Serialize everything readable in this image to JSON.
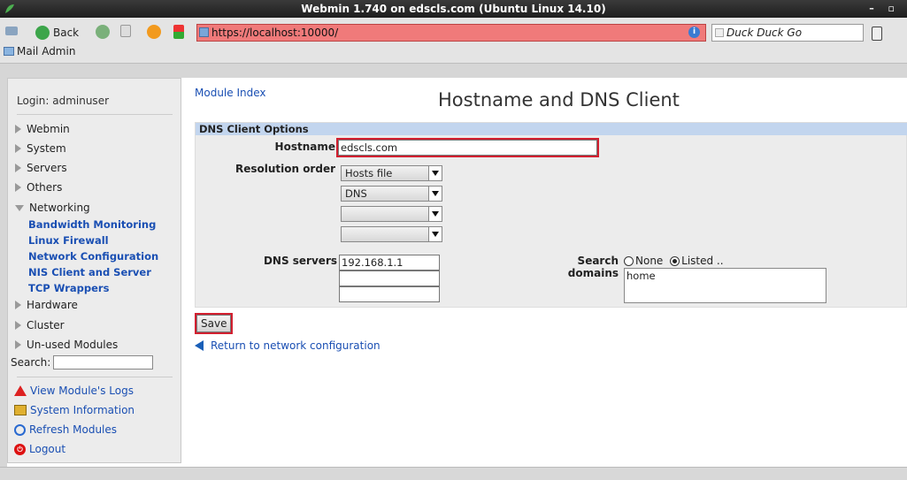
{
  "window": {
    "title": "Webmin 1.740 on edscls.com (Ubuntu Linux 14.10)",
    "controls": "– ▫"
  },
  "browser": {
    "back_label": "Back",
    "url": "https://localhost:10000/",
    "search_placeholder": "Duck Duck Go",
    "bookmark": "Mail Admin",
    "urlbar_color": "#f07a7a"
  },
  "sidebar": {
    "login": "Login: adminuser",
    "categories": [
      "Webmin",
      "System",
      "Servers",
      "Others",
      "Networking"
    ],
    "networking_items": [
      "Bandwidth Monitoring",
      "Linux Firewall",
      "Network Configuration",
      "NIS Client and Server",
      "TCP Wrappers"
    ],
    "more_categories": [
      "Hardware",
      "Cluster",
      "Un-used Modules"
    ],
    "search_label": "Search:",
    "actions": [
      "View Module's Logs",
      "System Information",
      "Refresh Modules",
      "Logout"
    ]
  },
  "main": {
    "module_index": "Module Index",
    "title": "Hostname and DNS Client",
    "section": "DNS Client Options",
    "hostname_label": "Hostname",
    "hostname_value": "edscls.com",
    "resolution_label": "Resolution order",
    "resolution": [
      "Hosts file",
      "DNS",
      "",
      ""
    ],
    "dns_servers_label": "DNS servers",
    "dns_servers": [
      "192.168.1.1",
      "",
      ""
    ],
    "search_domains_label": "Search domains",
    "radio_none": "None",
    "radio_listed": "Listed ..",
    "search_domains_value": "home",
    "save": "Save",
    "return_link": "Return to network configuration"
  }
}
